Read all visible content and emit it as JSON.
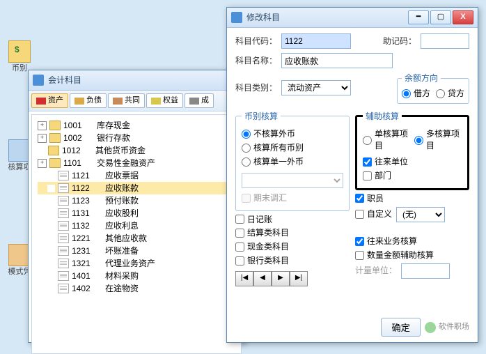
{
  "bg": {
    "label1": "币别",
    "label2": "核算项",
    "label3": "模式凭"
  },
  "winA": {
    "title": "会计科目",
    "tabs": [
      "资产",
      "负债",
      "共同",
      "权益",
      "成"
    ],
    "tree": [
      {
        "pm": "+",
        "type": "folder",
        "code": "1001",
        "name": "库存现金",
        "indent": 0
      },
      {
        "pm": "+",
        "type": "folder",
        "code": "1002",
        "name": "银行存款",
        "indent": 0
      },
      {
        "pm": "",
        "type": "folder",
        "code": "1012",
        "name": "其他货币资金",
        "indent": 0
      },
      {
        "pm": "+",
        "type": "folder",
        "code": "1101",
        "name": "交易性金融资产",
        "indent": 0
      },
      {
        "pm": "",
        "type": "file",
        "code": "1121",
        "name": "应收票据",
        "indent": 1
      },
      {
        "pm": "",
        "type": "file",
        "code": "1122",
        "name": "应收账款",
        "indent": 1,
        "sel": true
      },
      {
        "pm": "",
        "type": "file",
        "code": "1123",
        "name": "预付账款",
        "indent": 1
      },
      {
        "pm": "",
        "type": "file",
        "code": "1131",
        "name": "应收股利",
        "indent": 1
      },
      {
        "pm": "",
        "type": "file",
        "code": "1132",
        "name": "应收利息",
        "indent": 1
      },
      {
        "pm": "",
        "type": "file",
        "code": "1221",
        "name": "其他应收款",
        "indent": 1
      },
      {
        "pm": "",
        "type": "file",
        "code": "1231",
        "name": "坏账准备",
        "indent": 1
      },
      {
        "pm": "",
        "type": "file",
        "code": "1321",
        "name": "代理业务资产",
        "indent": 1
      },
      {
        "pm": "",
        "type": "file",
        "code": "1401",
        "name": "材料采购",
        "indent": 1
      },
      {
        "pm": "",
        "type": "file",
        "code": "1402",
        "name": "在途物资",
        "indent": 1
      }
    ]
  },
  "winB": {
    "title": "修改科目",
    "code_lbl": "科目代码：",
    "code_val": "1122",
    "mnem_lbl": "助记码：",
    "name_lbl": "科目名称：",
    "name_val": "应收账款",
    "cat_lbl": "科目类别：",
    "cat_val": "流动资产",
    "bal_legend": "余额方向",
    "bal_debit": "借方",
    "bal_credit": "贷方",
    "cur_legend": "币别核算",
    "cur_none": "不核算外币",
    "cur_all": "核算所有币别",
    "cur_one": "核算单一外币",
    "period_end": "期末调汇",
    "aux_legend": "辅助核算",
    "aux_single": "单核算项目",
    "aux_multi": "多核算项目",
    "aux_partner": "往来单位",
    "aux_dept": "部门",
    "aux_emp": "职员",
    "aux_custom": "自定义",
    "aux_custom_val": "(无)",
    "journal": "日记账",
    "settle": "结算类科目",
    "cash": "现金类科目",
    "bank": "银行类科目",
    "biz": "往来业务核算",
    "qty": "数量金额辅助核算",
    "unit_lbl": "计量单位：",
    "nav": [
      "|◀",
      "◀",
      "▶",
      "▶|"
    ],
    "ok": "确定",
    "wmtext": "软件职场"
  }
}
